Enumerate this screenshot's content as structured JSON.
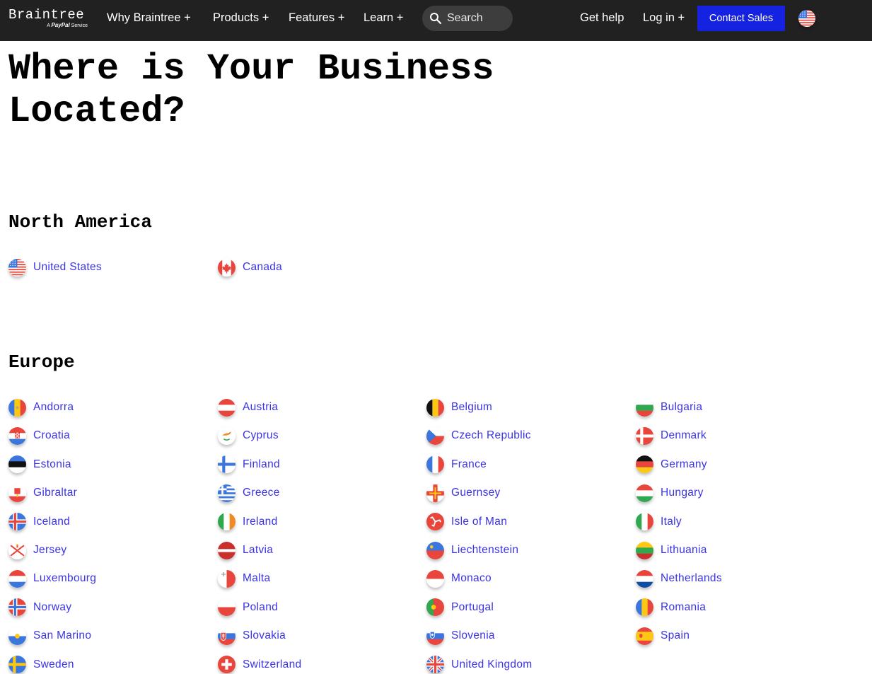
{
  "nav": {
    "logo": {
      "name": "Braintree",
      "sub_prefix": "A",
      "sub_brand": "PayPal",
      "sub_suffix": "Service"
    },
    "links": [
      {
        "label": "Why Braintree +"
      },
      {
        "label": "Products +"
      },
      {
        "label": "Features +"
      },
      {
        "label": "Learn +"
      }
    ],
    "search": {
      "label": "Search",
      "icon": "search-icon"
    },
    "get_help": "Get help",
    "login": "Log in +",
    "contact_sales": "Contact Sales",
    "contact_color": "#1522e0",
    "locale_flag": "us"
  },
  "page": {
    "title": "Where is Your Business Located?",
    "link_color": "#3a33e6"
  },
  "regions": [
    {
      "name": "North America",
      "countries": [
        {
          "name": "United States",
          "flag": "us"
        },
        {
          "name": "Canada",
          "flag": "ca"
        }
      ]
    },
    {
      "name": "Europe",
      "countries": [
        {
          "name": "Andorra",
          "flag": "ad"
        },
        {
          "name": "Austria",
          "flag": "at"
        },
        {
          "name": "Belgium",
          "flag": "be"
        },
        {
          "name": "Bulgaria",
          "flag": "bg"
        },
        {
          "name": "Croatia",
          "flag": "hr"
        },
        {
          "name": "Cyprus",
          "flag": "cy"
        },
        {
          "name": "Czech Republic",
          "flag": "cz"
        },
        {
          "name": "Denmark",
          "flag": "dk"
        },
        {
          "name": "Estonia",
          "flag": "ee"
        },
        {
          "name": "Finland",
          "flag": "fi"
        },
        {
          "name": "France",
          "flag": "fr"
        },
        {
          "name": "Germany",
          "flag": "de"
        },
        {
          "name": "Gibraltar",
          "flag": "gi"
        },
        {
          "name": "Greece",
          "flag": "gr"
        },
        {
          "name": "Guernsey",
          "flag": "gg"
        },
        {
          "name": "Hungary",
          "flag": "hu"
        },
        {
          "name": "Iceland",
          "flag": "is"
        },
        {
          "name": "Ireland",
          "flag": "ie"
        },
        {
          "name": "Isle of Man",
          "flag": "im"
        },
        {
          "name": "Italy",
          "flag": "it"
        },
        {
          "name": "Jersey",
          "flag": "je"
        },
        {
          "name": "Latvia",
          "flag": "lv"
        },
        {
          "name": "Liechtenstein",
          "flag": "li"
        },
        {
          "name": "Lithuania",
          "flag": "lt"
        },
        {
          "name": "Luxembourg",
          "flag": "lu"
        },
        {
          "name": "Malta",
          "flag": "mt"
        },
        {
          "name": "Monaco",
          "flag": "mc"
        },
        {
          "name": "Netherlands",
          "flag": "nl"
        },
        {
          "name": "Norway",
          "flag": "no"
        },
        {
          "name": "Poland",
          "flag": "pl"
        },
        {
          "name": "Portugal",
          "flag": "pt"
        },
        {
          "name": "Romania",
          "flag": "ro"
        },
        {
          "name": "San Marino",
          "flag": "sm"
        },
        {
          "name": "Slovakia",
          "flag": "sk"
        },
        {
          "name": "Slovenia",
          "flag": "si"
        },
        {
          "name": "Spain",
          "flag": "es"
        },
        {
          "name": "Sweden",
          "flag": "se"
        },
        {
          "name": "Switzerland",
          "flag": "ch"
        },
        {
          "name": "United Kingdom",
          "flag": "gb"
        }
      ]
    }
  ]
}
